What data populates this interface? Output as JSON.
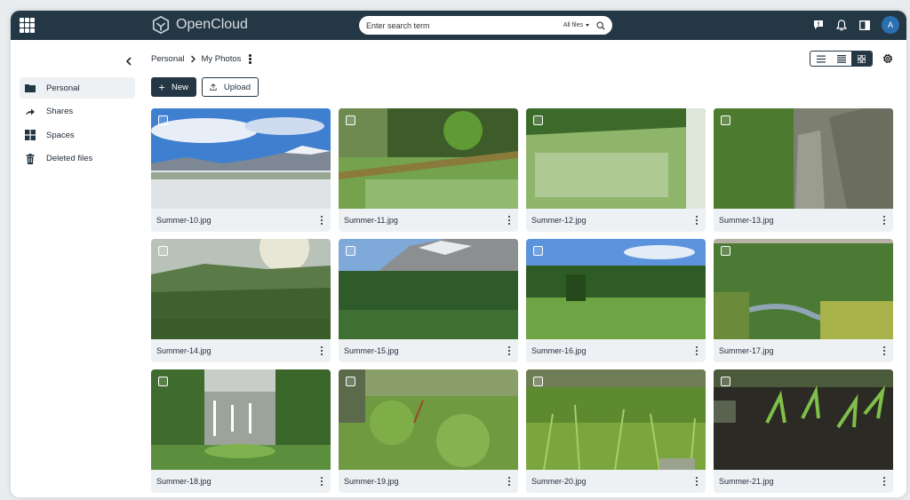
{
  "app": {
    "name": "OpenCloud"
  },
  "search": {
    "placeholder": "Enter search term",
    "scope": "All files"
  },
  "user": {
    "initial": "A"
  },
  "sidebar": {
    "items": [
      {
        "label": "Personal",
        "icon": "folder-icon",
        "active": true
      },
      {
        "label": "Shares",
        "icon": "share-icon",
        "active": false
      },
      {
        "label": "Spaces",
        "icon": "spaces-icon",
        "active": false
      },
      {
        "label": "Deleted files",
        "icon": "trash-icon",
        "active": false
      }
    ]
  },
  "breadcrumb": {
    "root": "Personal",
    "current": "My Photos"
  },
  "actions": {
    "new_label": "New",
    "upload_label": "Upload"
  },
  "view_modes": [
    "list-icon",
    "table-icon",
    "grid-icon"
  ],
  "active_view": "grid-icon",
  "files": [
    {
      "name": "Summer-10.jpg",
      "scene": "mountain-sky"
    },
    {
      "name": "Summer-11.jpg",
      "scene": "forest-log"
    },
    {
      "name": "Summer-12.jpg",
      "scene": "flower-slope"
    },
    {
      "name": "Summer-13.jpg",
      "scene": "rock-wall"
    },
    {
      "name": "Summer-14.jpg",
      "scene": "sunny-valley"
    },
    {
      "name": "Summer-15.jpg",
      "scene": "alpine-forest"
    },
    {
      "name": "Summer-16.jpg",
      "scene": "meadow"
    },
    {
      "name": "Summer-17.jpg",
      "scene": "river-gorge"
    },
    {
      "name": "Summer-18.jpg",
      "scene": "waterfall"
    },
    {
      "name": "Summer-19.jpg",
      "scene": "moss-ground"
    },
    {
      "name": "Summer-20.jpg",
      "scene": "grass"
    },
    {
      "name": "Summer-21.jpg",
      "scene": "dark-soil"
    }
  ]
}
